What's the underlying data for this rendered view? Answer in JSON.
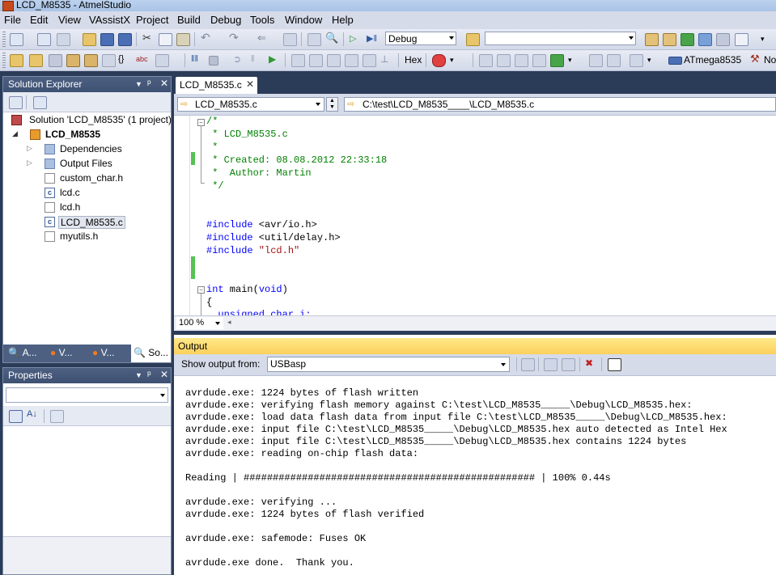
{
  "window": {
    "title": "LCD_M8535 - AtmelStudio"
  },
  "menu": [
    "File",
    "Edit",
    "View",
    "VAssistX",
    "Project",
    "Build",
    "Debug",
    "Tools",
    "Window",
    "Help"
  ],
  "toolbar1": {
    "config_value": "Debug",
    "platform_value": ""
  },
  "toolbar2": {
    "hex_label": "Hex",
    "device_label": "ATmega8535",
    "tool_label": "No"
  },
  "solution_explorer": {
    "title": "Solution Explorer",
    "solution_label": "Solution 'LCD_M8535' (1 project)",
    "project_label": "LCD_M8535",
    "items": [
      "Dependencies",
      "Output Files",
      "custom_char.h",
      "lcd.c",
      "lcd.h",
      "LCD_M8535.c",
      "myutils.h"
    ],
    "bottom_tabs": [
      "A...",
      "V...",
      "V...",
      "So..."
    ]
  },
  "properties": {
    "title": "Properties",
    "object_value": ""
  },
  "editor": {
    "tab_label": "LCD_M8535.c",
    "nav_left": "LCD_M8535.c",
    "nav_right": "C:\\test\\LCD_M8535____\\LCD_M8535.c",
    "zoom": "100 %",
    "lines": {
      "l1": "/*",
      "l2": " * LCD_M8535.c",
      "l3": " *",
      "l4": " * Created: 08.08.2012 22:33:18",
      "l5": " *  Author: Martin",
      "l6": " */",
      "inc_kw": "#include",
      "inc1": " <avr/io.h>",
      "inc2": " <util/delay.h>",
      "inc3": " \"lcd.h\"",
      "main_kw": "int",
      "main_rest": " main(",
      "void_kw": "void",
      "main_close": ")",
      "brace": "{",
      "partial": "  unsigned char i;"
    }
  },
  "output": {
    "title": "Output",
    "show_from_label": "Show output from:",
    "source_value": "USBasp",
    "lines": [
      "avrdude.exe: 1224 bytes of flash written",
      "avrdude.exe: verifying flash memory against C:\\test\\LCD_M8535_____\\Debug\\LCD_M8535.hex:",
      "avrdude.exe: load data flash data from input file C:\\test\\LCD_M8535_____\\Debug\\LCD_M8535.hex:",
      "avrdude.exe: input file C:\\test\\LCD_M8535_____\\Debug\\LCD_M8535.hex auto detected as Intel Hex",
      "avrdude.exe: input file C:\\test\\LCD_M8535_____\\Debug\\LCD_M8535.hex contains 1224 bytes",
      "avrdude.exe: reading on-chip flash data:",
      "",
      "Reading | ################################################## | 100% 0.44s",
      "",
      "avrdude.exe: verifying ...",
      "avrdude.exe: 1224 bytes of flash verified",
      "",
      "avrdude.exe: safemode: Fuses OK",
      "",
      "avrdude.exe done.  Thank you."
    ]
  }
}
